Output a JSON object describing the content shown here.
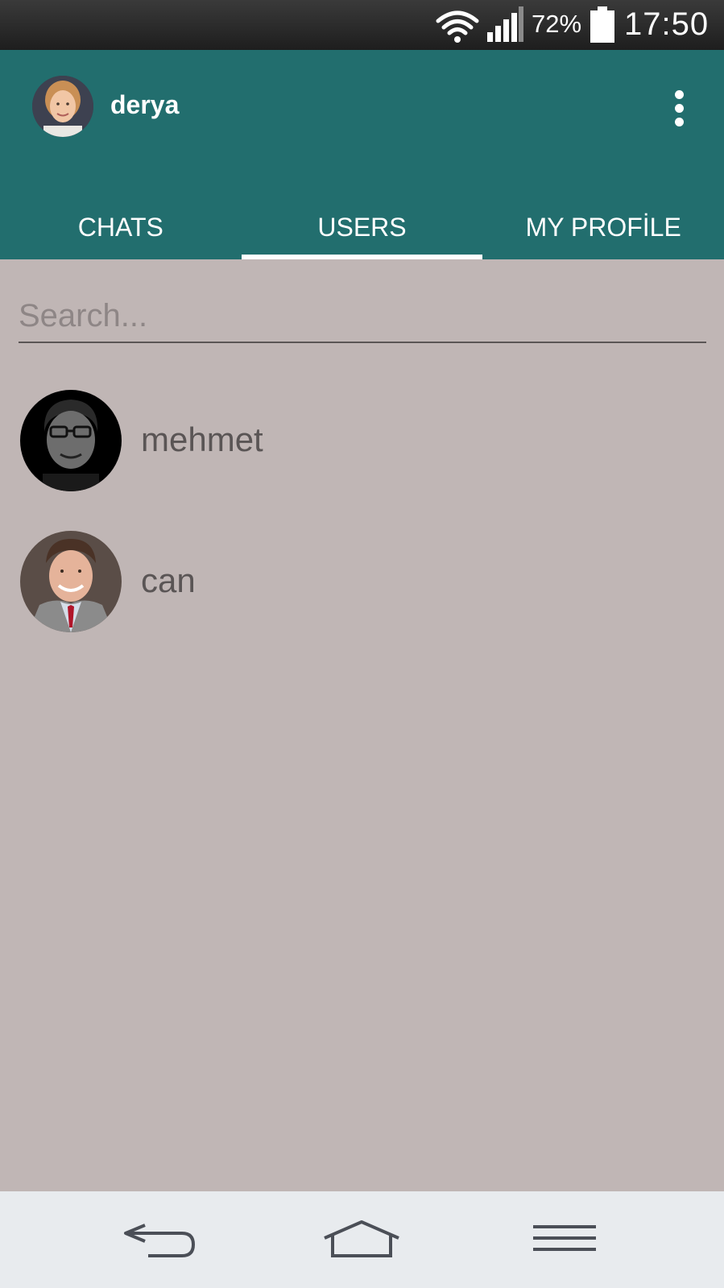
{
  "status_bar": {
    "battery_percent": "72%",
    "time": "17:50",
    "icons": [
      "wifi-icon",
      "signal-icon",
      "battery-icon"
    ]
  },
  "app_bar": {
    "username": "derya",
    "menu_icon": "more-vert-icon"
  },
  "tabs": [
    {
      "label": "CHATS",
      "active": false
    },
    {
      "label": "USERS",
      "active": true
    },
    {
      "label": "MY PROFİLE",
      "active": false
    }
  ],
  "search": {
    "placeholder": "Search...",
    "value": ""
  },
  "users": [
    {
      "name": "mehmet"
    },
    {
      "name": "can"
    }
  ],
  "nav_bar": {
    "icons": [
      "back-icon",
      "home-icon",
      "menu-icon"
    ]
  },
  "colors": {
    "app_bar": "#226e6e",
    "background": "#c0b6b5",
    "nav_bar": "#e8ebee"
  }
}
